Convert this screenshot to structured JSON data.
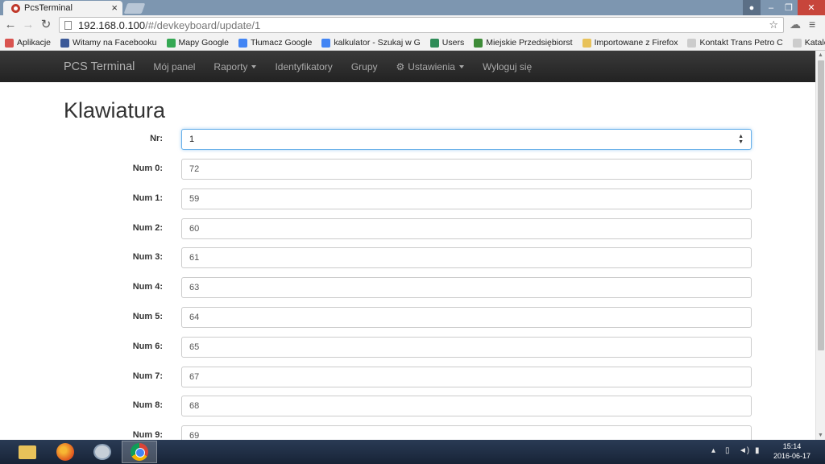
{
  "browser": {
    "tab_title": "PcsTerminal",
    "url_host": "192.168.0.100",
    "url_path": "/#/devkeyboard/update/1",
    "bookmarks": [
      {
        "label": "Aplikacje",
        "color": "#d9534f"
      },
      {
        "label": "Witamy na Facebooku",
        "color": "#3b5998"
      },
      {
        "label": "Mapy Google",
        "color": "#34a853"
      },
      {
        "label": "Tłumacz Google",
        "color": "#4285f4"
      },
      {
        "label": "kalkulator - Szukaj w G",
        "color": "#4285f4"
      },
      {
        "label": "Users",
        "color": "#2e8b57"
      },
      {
        "label": "Miejskie Przedsiębiorst",
        "color": "#3d8b37"
      },
      {
        "label": "Importowane z Firefox",
        "color": "#e8c25a"
      },
      {
        "label": "Kontakt Trans Petro C",
        "color": "#cccccc"
      },
      {
        "label": "Katalog stron OSP",
        "color": "#cccccc"
      }
    ]
  },
  "navbar": {
    "brand": "PCS Terminal",
    "items": [
      {
        "label": "Mój panel",
        "dropdown": false
      },
      {
        "label": "Raporty",
        "dropdown": true
      },
      {
        "label": "Identyfikatory",
        "dropdown": false
      },
      {
        "label": "Grupy",
        "dropdown": false
      },
      {
        "label": "Ustawienia",
        "dropdown": true,
        "icon": "gear-icon"
      },
      {
        "label": "Wyloguj się",
        "dropdown": false
      }
    ]
  },
  "page": {
    "title": "Klawiatura",
    "nr_label": "Nr:",
    "nr_value": "1",
    "fields": [
      {
        "label": "Num 0:",
        "value": "72"
      },
      {
        "label": "Num 1:",
        "value": "59"
      },
      {
        "label": "Num 2:",
        "value": "60"
      },
      {
        "label": "Num 3:",
        "value": "61"
      },
      {
        "label": "Num 4:",
        "value": "63"
      },
      {
        "label": "Num 5:",
        "value": "64"
      },
      {
        "label": "Num 6:",
        "value": "65"
      },
      {
        "label": "Num 7:",
        "value": "67"
      },
      {
        "label": "Num 8:",
        "value": "68"
      },
      {
        "label": "Num 9:",
        "value": "69"
      }
    ]
  },
  "taskbar": {
    "time": "15:14",
    "date": "2016-06-17"
  }
}
